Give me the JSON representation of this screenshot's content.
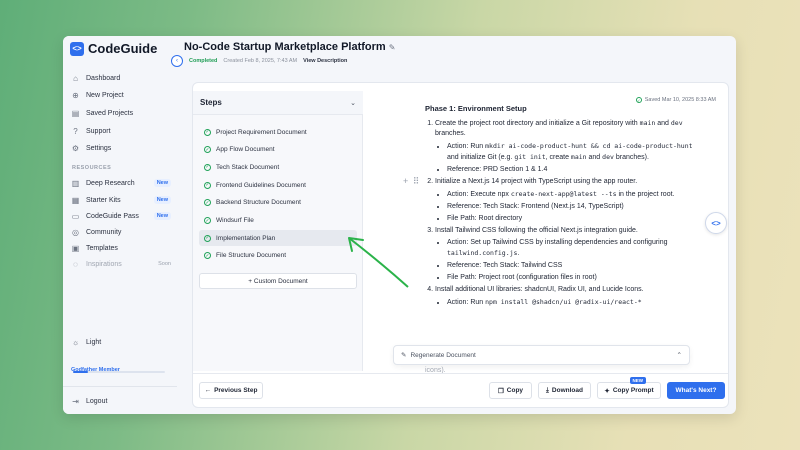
{
  "brand": {
    "logo": "<>",
    "name": "CodeGuide"
  },
  "sidebar": {
    "items": [
      {
        "icon": "home-icon",
        "glyph": "⌂",
        "label": "Dashboard"
      },
      {
        "icon": "plus-circle-icon",
        "glyph": "⊕",
        "label": "New Project"
      },
      {
        "icon": "folder-icon",
        "glyph": "▤",
        "label": "Saved Projects"
      },
      {
        "icon": "help-icon",
        "glyph": "?",
        "label": "Support"
      },
      {
        "icon": "gear-icon",
        "glyph": "⚙",
        "label": "Settings"
      }
    ],
    "resources_label": "RESOURCES",
    "resources": [
      {
        "icon": "book-icon",
        "glyph": "▥",
        "label": "Deep Research",
        "badge": "New"
      },
      {
        "icon": "grid-icon",
        "glyph": "▦",
        "label": "Starter Kits",
        "badge": "New"
      },
      {
        "icon": "ticket-icon",
        "glyph": "▭",
        "label": "CodeGuide Pass",
        "badge": "New"
      },
      {
        "icon": "users-icon",
        "glyph": "◎",
        "label": "Community",
        "badge": ""
      },
      {
        "icon": "template-icon",
        "glyph": "▣",
        "label": "Templates",
        "badge": ""
      },
      {
        "icon": "bulb-icon",
        "glyph": "◌",
        "label": "Inspirations",
        "soon": "Soon"
      }
    ],
    "theme_label": "Light",
    "member_label": "Godfather Member",
    "member_progress": 0.16,
    "logout_label": "Logout"
  },
  "header": {
    "title": "No-Code Startup Marketplace Platform",
    "status": "Completed",
    "created": "Created Feb 8, 2025, 7:43 AM",
    "view_description": "View Description"
  },
  "steps": {
    "title": "Steps",
    "items": [
      "Project Requirement Document",
      "App Flow Document",
      "Tech Stack Document",
      "Frontend Guidelines Document",
      "Backend Structure Document",
      "Windsurf File",
      "Implementation Plan",
      "File Structure Document"
    ],
    "active_index": 6,
    "custom_button": "+ Custom Document"
  },
  "document": {
    "saved": "Saved Mar 10, 2025 8:33 AM",
    "heading": "Phase 1: Environment Setup",
    "regenerate_label": "Regenerate Document",
    "trailing_text": "icons)."
  },
  "footer": {
    "previous": "Previous Step",
    "copy": "Copy",
    "download": "Download",
    "copy_prompt": "Copy Prompt",
    "new_tag": "NEW",
    "next": "What's Next?"
  }
}
